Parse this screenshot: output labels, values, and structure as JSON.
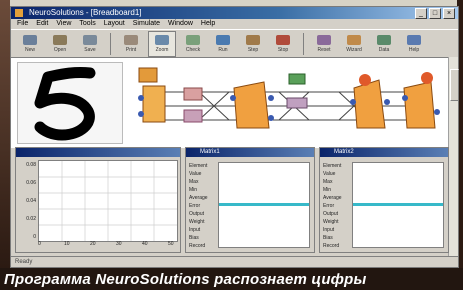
{
  "window": {
    "title": "NeuroSolutions - [Breadboard1]",
    "controls": {
      "minimize": "_",
      "maximize": "□",
      "close": "×"
    }
  },
  "menu": [
    "File",
    "Edit",
    "View",
    "Tools",
    "Layout",
    "Simulate",
    "Window",
    "Help"
  ],
  "toolbar": [
    {
      "name": "new-tool",
      "label": "New",
      "color": "#6a7f9a"
    },
    {
      "name": "open-tool",
      "label": "Open",
      "color": "#8a7a5a"
    },
    {
      "name": "save-tool",
      "label": "Save",
      "color": "#7a8a9a"
    },
    {
      "name": "print-tool",
      "label": "Print",
      "color": "#9a8a7a"
    },
    {
      "name": "zoom-tool",
      "label": "Zoom",
      "color": "#6a8aaa"
    },
    {
      "name": "check-tool",
      "label": "Check",
      "color": "#7aa07a"
    },
    {
      "name": "run-tool",
      "label": "Run",
      "color": "#4a7ab0"
    },
    {
      "name": "step-tool",
      "label": "Step",
      "color": "#a07a4a"
    },
    {
      "name": "stop-tool",
      "label": "Stop",
      "color": "#b04a3a"
    },
    {
      "name": "reset-tool",
      "label": "Reset",
      "color": "#8a6a9a"
    },
    {
      "name": "wizard-tool",
      "label": "Wizard",
      "color": "#c08a4a"
    },
    {
      "name": "data-tool",
      "label": "Data",
      "color": "#5a8a6a"
    },
    {
      "name": "help-tool",
      "label": "Help",
      "color": "#5a7ab0"
    }
  ],
  "active_tool_index": 4,
  "panels": {
    "plot": {
      "title": "",
      "yticks": [
        "0.08",
        "0.06",
        "0.04",
        "0.02",
        "0"
      ],
      "xticks": [
        "0",
        "10",
        "20",
        "30",
        "40",
        "50"
      ]
    },
    "matrix1": {
      "title": "Matrix1",
      "rows": [
        "Element",
        "Value",
        "Max",
        "Min",
        "Average",
        "Error",
        "Output",
        "Weight",
        "Input",
        "Bias",
        "Record"
      ]
    },
    "matrix2": {
      "title": "Matrix2",
      "rows": [
        "Element",
        "Value",
        "Max",
        "Min",
        "Average",
        "Error",
        "Output",
        "Weight",
        "Input",
        "Bias",
        "Record"
      ]
    }
  },
  "status": {
    "text": "Ready"
  },
  "caption": "Программа NeuroSolutions распознает цифры"
}
